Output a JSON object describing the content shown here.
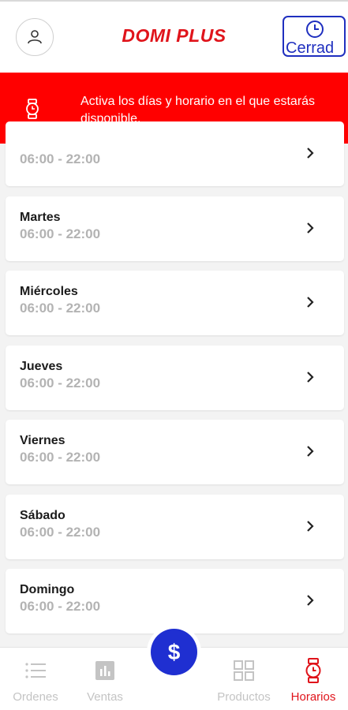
{
  "header": {
    "title": "DOMI PLUS",
    "status_label": "Cerrad",
    "accent_color": "#e0141b",
    "status_color": "#1f2fbf"
  },
  "banner": {
    "message": "Activa los días y horario en el que estarás disponible."
  },
  "schedule": [
    {
      "day": "",
      "hours": "06:00 - 22:00"
    },
    {
      "day": "Martes",
      "hours": "06:00 - 22:00"
    },
    {
      "day": "Miércoles",
      "hours": "06:00 - 22:00"
    },
    {
      "day": "Jueves",
      "hours": "06:00 - 22:00"
    },
    {
      "day": "Viernes",
      "hours": "06:00 - 22:00"
    },
    {
      "day": "Sábado",
      "hours": "06:00 - 22:00"
    },
    {
      "day": "Domingo",
      "hours": "06:00 - 22:00"
    }
  ],
  "nav": {
    "ordenes": "Ordenes",
    "ventas": "Ventas",
    "fab_symbol": "$",
    "productos": "Productos",
    "horarios": "Horarios",
    "active": "horarios"
  }
}
